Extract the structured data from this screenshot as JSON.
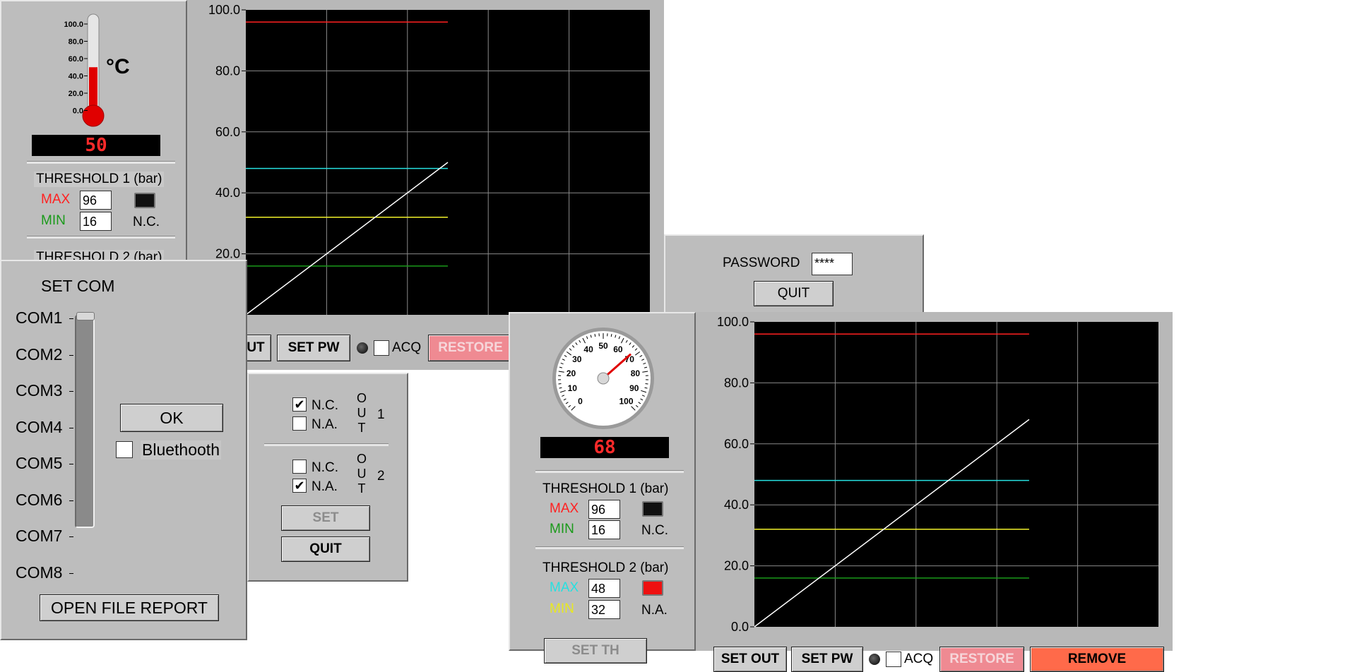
{
  "colors": {
    "panel": "#bdbdbd",
    "graph_bg": "#000000",
    "grid": "#8a8a8a",
    "max1": "#ff2020",
    "min1": "#1a9a1a",
    "max2": "#26e0e0",
    "min2": "#f0f02a",
    "restore": "#ef8a92",
    "remove": "#ff6a4a",
    "digital_text": "#ff2a2a"
  },
  "window_a": {
    "thermometer": {
      "scale": [
        "100.0",
        "80.0",
        "60.0",
        "40.0",
        "20.0",
        "0.0"
      ],
      "unit": "°C",
      "level_value": 50
    },
    "digital_value": "50",
    "threshold1": {
      "title": "THRESHOLD 1 (bar)",
      "max_label": "MAX",
      "max_value": "96",
      "min_label": "MIN",
      "min_value": "16",
      "state": "N.C."
    },
    "threshold2_title": "THRESHOLD 2 (bar)",
    "buttons": {
      "set_out_partial": "UT",
      "set_pw": "SET PW",
      "acq": "ACQ",
      "restore": "RESTORE"
    }
  },
  "chart_a": {
    "y_ticks": [
      "100.0",
      "80.0",
      "60.0",
      "40.0",
      "20.0"
    ]
  },
  "set_com": {
    "title": "SET COM",
    "ports": [
      "COM1",
      "COM2",
      "COM3",
      "COM4",
      "COM5",
      "COM6",
      "COM7",
      "COM8"
    ],
    "ok": "OK",
    "bluetooth": "Bluethooth",
    "bluetooth_checked": false,
    "open_file_report": "OPEN FILE REPORT"
  },
  "outputs": {
    "out1": {
      "nc": "N.C.",
      "nc_checked": true,
      "na": "N.A.",
      "na_checked": false,
      "vlabel": [
        "O",
        "U",
        "T"
      ],
      "num": "1"
    },
    "out2": {
      "nc": "N.C.",
      "nc_checked": false,
      "na": "N.A.",
      "na_checked": true,
      "vlabel": [
        "O",
        "U",
        "T"
      ],
      "num": "2"
    },
    "set": "SET",
    "quit": "QUIT"
  },
  "password": {
    "label": "PASSWORD",
    "value": "****",
    "quit": "QUIT"
  },
  "window_b": {
    "gauge": {
      "labels": [
        "0",
        "10",
        "20",
        "30",
        "40",
        "50",
        "60",
        "70",
        "80",
        "90",
        "100"
      ],
      "value": 68
    },
    "digital_value": "68",
    "threshold1": {
      "title": "THRESHOLD 1 (bar)",
      "max_label": "MAX",
      "max_value": "96",
      "min_label": "MIN",
      "min_value": "16",
      "state": "N.C."
    },
    "threshold2": {
      "title": "THRESHOLD 2 (bar)",
      "max_label": "MAX",
      "max_value": "48",
      "min_label": "MIN",
      "min_value": "32",
      "state": "N.A."
    },
    "buttons": {
      "set_th": "SET TH",
      "set_out": "SET OUT",
      "set_pw": "SET PW",
      "acq": "ACQ",
      "restore": "RESTORE",
      "remove": "REMOVE"
    }
  },
  "chart_b": {
    "y_ticks": [
      "100.0",
      "80.0",
      "60.0",
      "40.0",
      "20.0",
      "0.0"
    ]
  },
  "chart_data": [
    {
      "type": "line",
      "title": "",
      "xlabel": "",
      "ylabel": "",
      "ylim": [
        0,
        100
      ],
      "grid": true,
      "x_extent_fraction": 0.5,
      "series": [
        {
          "name": "",
          "color": "#ff2020",
          "x": [
            0,
            0.5
          ],
          "y": [
            96,
            96
          ]
        },
        {
          "name": "",
          "color": "#26e0e0",
          "x": [
            0,
            0.5
          ],
          "y": [
            48,
            48
          ]
        },
        {
          "name": "",
          "color": "#f0f02a",
          "x": [
            0,
            0.5
          ],
          "y": [
            32,
            32
          ]
        },
        {
          "name": "",
          "color": "#1a9a1a",
          "x": [
            0,
            0.5
          ],
          "y": [
            16,
            16
          ]
        },
        {
          "name": "",
          "color": "#ffffff",
          "x": [
            0,
            0.5
          ],
          "y": [
            0,
            50
          ]
        }
      ]
    },
    {
      "type": "line",
      "title": "",
      "xlabel": "",
      "ylabel": "",
      "ylim": [
        0,
        100
      ],
      "grid": true,
      "x_extent_fraction": 0.68,
      "series": [
        {
          "name": "",
          "color": "#ff2020",
          "x": [
            0,
            0.68
          ],
          "y": [
            96,
            96
          ]
        },
        {
          "name": "",
          "color": "#26e0e0",
          "x": [
            0,
            0.68
          ],
          "y": [
            48,
            48
          ]
        },
        {
          "name": "",
          "color": "#f0f02a",
          "x": [
            0,
            0.68
          ],
          "y": [
            32,
            32
          ]
        },
        {
          "name": "",
          "color": "#1a9a1a",
          "x": [
            0,
            0.68
          ],
          "y": [
            16,
            16
          ]
        },
        {
          "name": "",
          "color": "#ffffff",
          "x": [
            0,
            0.68
          ],
          "y": [
            0,
            68
          ]
        }
      ]
    }
  ]
}
